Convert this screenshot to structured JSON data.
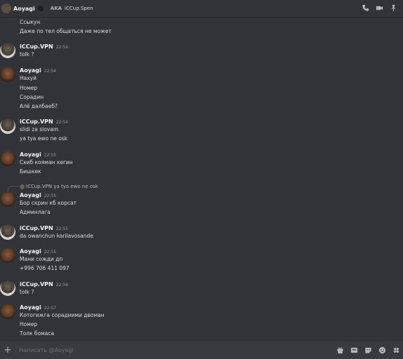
{
  "header": {
    "username": "Aoyagi",
    "aka_label": "AKA",
    "alt_name": "iCCup.Spen",
    "tool_icons": [
      "phone-icon",
      "video-icon",
      "pin-icon"
    ]
  },
  "messages": {
    "m0": {
      "lines": [
        "Ссыкун",
        "Даже по тел общаться не может"
      ]
    },
    "m1": {
      "author": "iCCup.VPN",
      "time": "22:54",
      "lines": [
        "tolk ?"
      ]
    },
    "m2": {
      "author": "Aoyagi",
      "time": "22:54",
      "lines": [
        "Нахуй",
        "Номер",
        "Сорадин",
        "Алё далбаеб?"
      ]
    },
    "m3": {
      "author": "iCCup.VPN",
      "time": "22:54",
      "lines": [
        "slidi za slovam",
        "ya tya ewo ne osk"
      ]
    },
    "m4": {
      "author": "Aoyagi",
      "time": "22:55",
      "lines": [
        "Скиб кояман кегин",
        "Бишкек"
      ]
    },
    "m5": {
      "reply_author": "iCCup.VPN",
      "reply_text": "ya tya ewo ne osk",
      "author": "Aoyagi",
      "time": "22:55",
      "lines": [
        "Бор скрин кб корсат",
        "Админлага"
      ]
    },
    "m6": {
      "author": "iCCup.VPN",
      "time": "22:55",
      "lines": [
        "da owanchun karilavosande"
      ]
    },
    "m7": {
      "author": "Aoyagi",
      "time": "22:55",
      "lines": [
        "Мани сожди дп",
        "+996 706 411 097"
      ]
    },
    "m8": {
      "author": "iCCup.VPN",
      "time": "22:56",
      "lines": [
        "tolk ?"
      ]
    },
    "m9": {
      "author": "Aoyagi",
      "time": "22:57",
      "lines": [
        "Котогижга сорадиими двоман",
        "Номер",
        "Толк бомаса"
      ]
    }
  },
  "composer": {
    "placeholder": "Написать @Aoyagi",
    "tool_icons": [
      "gift-icon",
      "gif-icon",
      "sticker-icon",
      "emoji-icon",
      "apps-icon"
    ]
  },
  "colors": {
    "background": "#313338",
    "composer": "#383a40",
    "username": "#f2f3f5",
    "timestamp": "#949ba4",
    "text": "#dbdee1"
  }
}
